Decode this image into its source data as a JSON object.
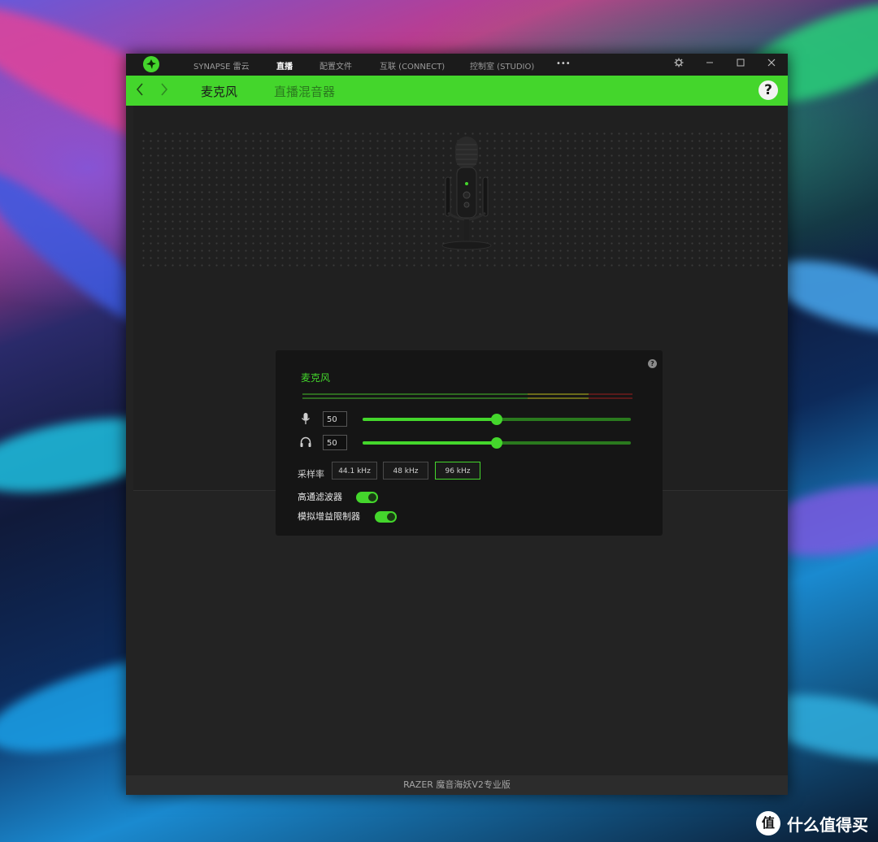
{
  "app": {
    "nav": [
      {
        "label": "SYNAPSE 雷云",
        "active": false
      },
      {
        "label": "直播",
        "active": true
      },
      {
        "label": "配置文件",
        "active": false
      },
      {
        "label": "互联 (CONNECT)",
        "active": false
      },
      {
        "label": "控制室 (STUDIO)",
        "active": false
      }
    ],
    "more_label": "•••",
    "window_controls": [
      "gear-icon",
      "minimize-icon",
      "maximize-icon",
      "close-icon"
    ]
  },
  "subnav": {
    "tabs": [
      {
        "label": "麦克风",
        "active": true
      },
      {
        "label": "直播混音器",
        "active": false
      }
    ],
    "help_label": "?"
  },
  "panel": {
    "title": "麦克风",
    "help_label": "?",
    "mic_gain": {
      "value": "50",
      "level": 0.5,
      "icon": "microphone-icon"
    },
    "monitor": {
      "value": "50",
      "level": 0.5,
      "icon": "headphones-icon"
    },
    "sample_rate": {
      "label": "采样率",
      "options": [
        "44.1 kHz",
        "48 kHz",
        "96 kHz"
      ],
      "selected": "96 kHz"
    },
    "toggles": [
      {
        "label": "高通滤波器",
        "on": true
      },
      {
        "label": "模拟增益限制器",
        "on": true
      }
    ]
  },
  "status_bar": {
    "device": "RAZER 魔音海妖V2专业版"
  },
  "watermark": {
    "logo": "值",
    "text": "什么值得买"
  },
  "colors": {
    "accent": "#44d62c",
    "background": "#232323",
    "panel": "#151515"
  }
}
